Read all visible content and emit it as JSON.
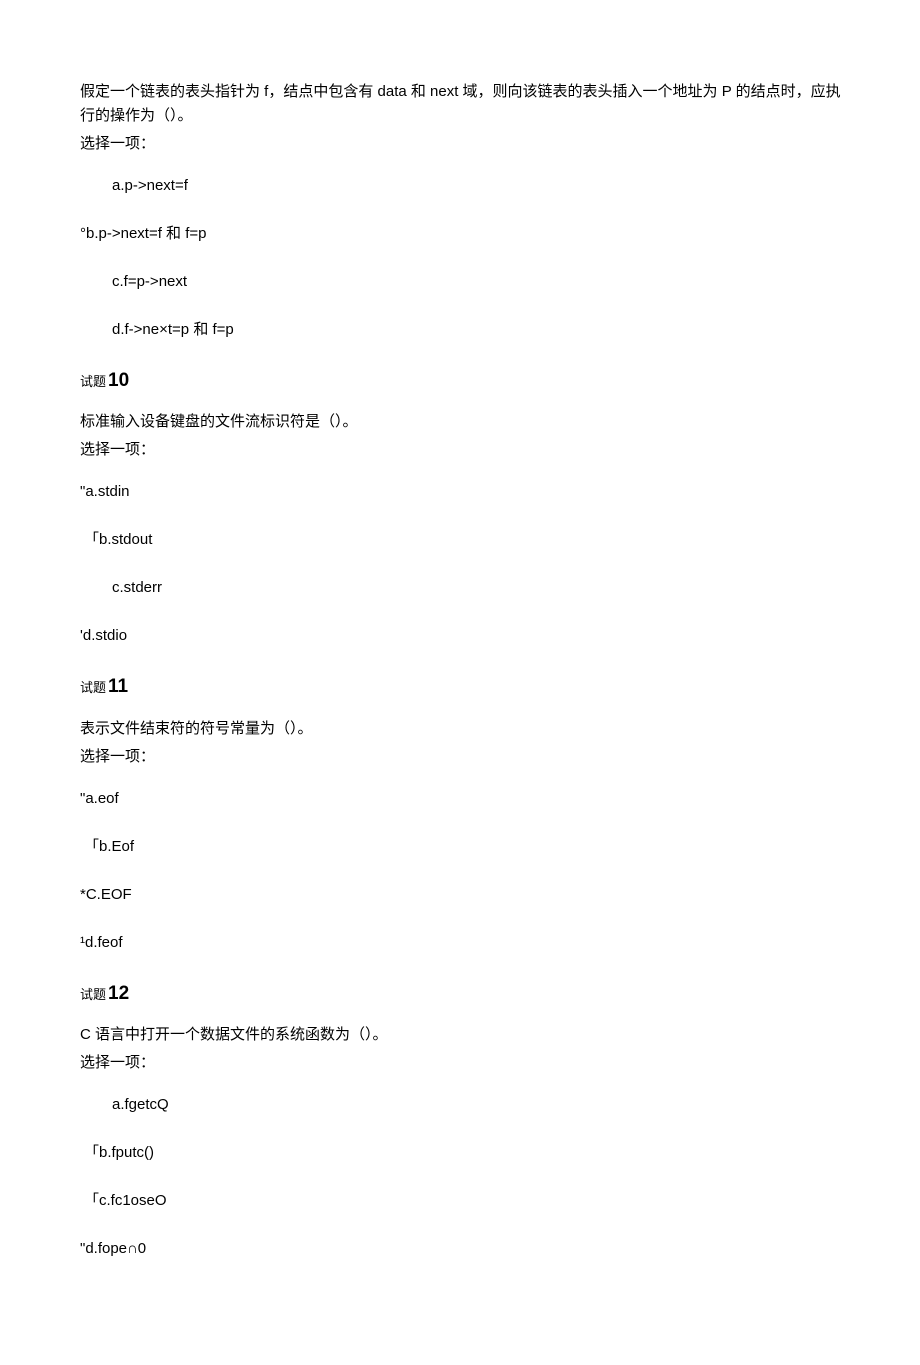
{
  "q9": {
    "text": "假定一个链表的表头指针为 f，结点中包含有 data 和 next 域，则向该链表的表头插入一个地址为 P 的结点时，应执行的操作为（）。",
    "select": "选择一项：",
    "options": {
      "a": "a.p->next=f",
      "b": "°b.p->next=f 和 f=p",
      "c": "c.f=p->next",
      "d": "d.f->ne×t=p 和 f=p"
    }
  },
  "q10": {
    "prefix": "试题",
    "num": "10",
    "text": "标准输入设备键盘的文件流标识符是（）。",
    "select": "选择一项：",
    "options": {
      "a": "\"a.stdin",
      "b": "「b.stdout",
      "c": "c.stderr",
      "d": "'d.stdio"
    }
  },
  "q11": {
    "prefix": "试题",
    "num": "11",
    "text": "表示文件结束符的符号常量为（）。",
    "select": "选择一项：",
    "options": {
      "a": "\"a.eof",
      "b": "「b.Eof",
      "c": "*C.EOF",
      "d": "¹d.feof"
    }
  },
  "q12": {
    "prefix": "试题",
    "num": "12",
    "text": "C 语言中打开一个数据文件的系统函数为（）。",
    "select": "选择一项：",
    "options": {
      "a": "a.fgetcQ",
      "b": "「b.fputc()",
      "c": "「c.fc1oseO",
      "d": "\"d.fope∩0"
    }
  }
}
